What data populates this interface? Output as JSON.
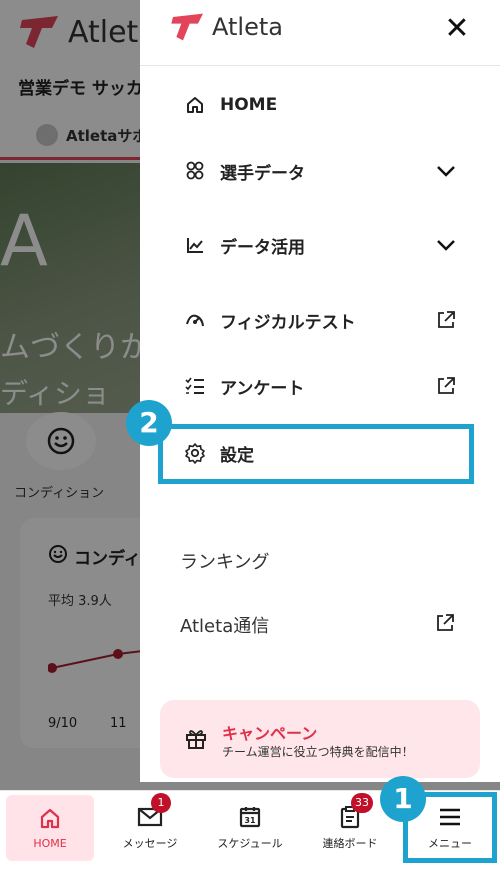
{
  "background": {
    "logo_text": "Atlet",
    "team_name": "営業デモ サッカ",
    "user_name": "Atletaサポ",
    "banner_logo": "A",
    "banner_line1": "ムづくりか",
    "banner_line2": "ディショ",
    "quick_label": "コンディション",
    "card_title": "コンディ",
    "card_avg": "平均 3.9人",
    "x_labels": [
      "9/10",
      "11"
    ]
  },
  "drawer": {
    "logo_text": "Atleta",
    "close_label": "✕",
    "items": [
      {
        "label": "HOME",
        "icon": "home-icon"
      },
      {
        "label": "選手データ",
        "icon": "players-icon"
      },
      {
        "label": "データ活用",
        "icon": "chart-icon"
      },
      {
        "label": "フィジカルテスト",
        "icon": "physical-icon"
      },
      {
        "label": "アンケート",
        "icon": "checklist-icon"
      },
      {
        "label": "設定",
        "icon": "gear-icon"
      }
    ],
    "plain_items": [
      {
        "label": "ランキング"
      },
      {
        "label": "Atleta通信"
      }
    ],
    "campaign": {
      "title": "キャンペーン",
      "subtitle": "チーム運営に役立つ特典を配信中！"
    }
  },
  "annotations": {
    "step1": "1",
    "step2": "2",
    "color": "#1ea3cf"
  },
  "bottom_nav": [
    {
      "label": "HOME",
      "icon": "home-icon",
      "active": true
    },
    {
      "label": "メッセージ",
      "icon": "mail-icon",
      "badge": "1"
    },
    {
      "label": "スケジュール",
      "icon": "calendar-icon",
      "icon_text": "31"
    },
    {
      "label": "連絡ボード",
      "icon": "clipboard-icon",
      "badge": "33"
    },
    {
      "label": "メニュー",
      "icon": "hamburger-icon"
    }
  ],
  "colors": {
    "brand": "#e0304a",
    "active_bg": "#ffe3e8"
  }
}
